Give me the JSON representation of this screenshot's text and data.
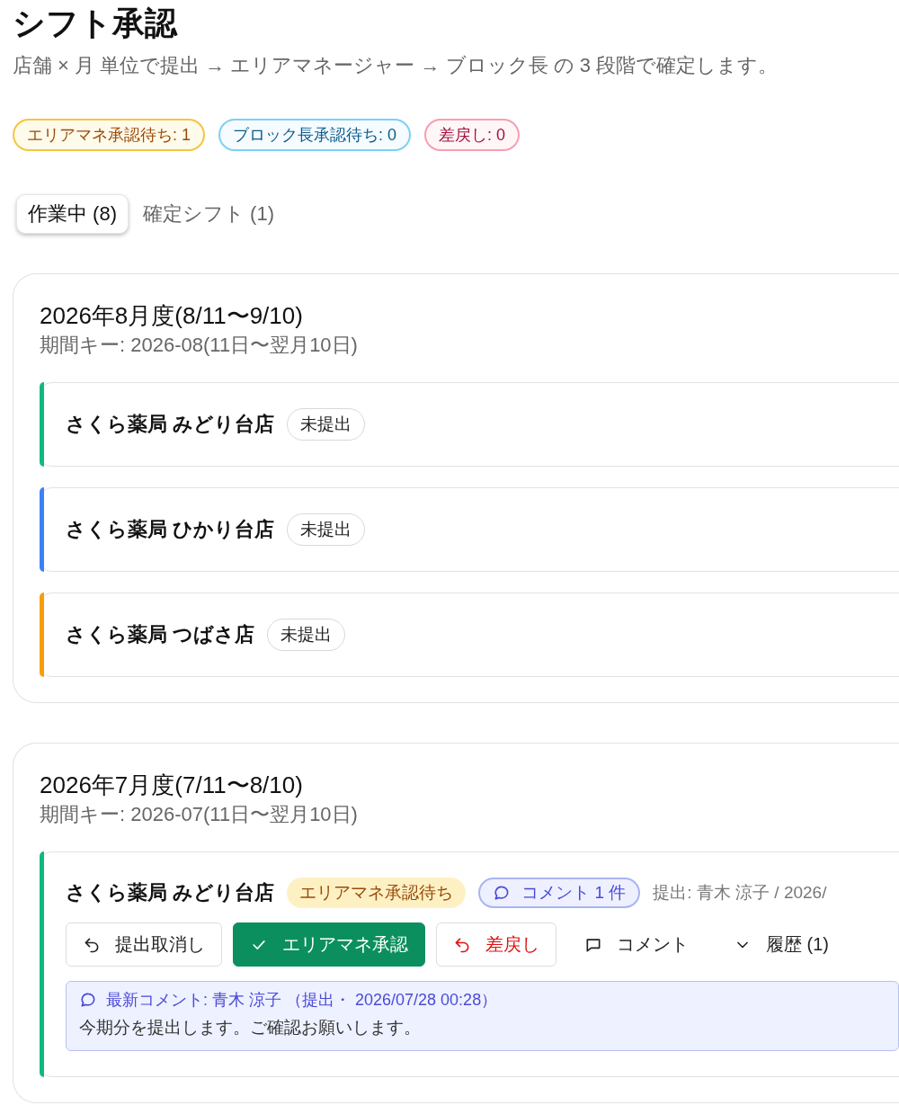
{
  "page": {
    "title": "シフト承認",
    "subtitle": "店舗 × 月 単位で提出 → エリアマネージャー → ブロック長 の 3 段階で確定します。"
  },
  "summary_badges": [
    {
      "label": "エリアマネ承認待ち: 1",
      "kind": "pending"
    },
    {
      "label": "ブロック長承認待ち: 0",
      "kind": "block"
    },
    {
      "label": "差戻し: 0",
      "kind": "returned"
    }
  ],
  "tabs": [
    {
      "label": "作業中 (8)",
      "selected": true
    },
    {
      "label": "確定シフト (1)",
      "selected": false
    }
  ],
  "periods": [
    {
      "title": "2026年8月度(8/11〜9/10)",
      "key": "期間キー: 2026-08(11日〜翌月10日)",
      "stores": [
        {
          "name": "さくら薬局 みどり台店",
          "color": "#10b981",
          "status": {
            "label": "未提出",
            "kind": "draft"
          }
        },
        {
          "name": "さくら薬局 ひかり台店",
          "color": "#3b82f6",
          "status": {
            "label": "未提出",
            "kind": "draft"
          }
        },
        {
          "name": "さくら薬局 つばさ店",
          "color": "#f59e0b",
          "status": {
            "label": "未提出",
            "kind": "draft"
          }
        }
      ]
    },
    {
      "title": "2026年7月度(7/11〜8/10)",
      "key": "期間キー: 2026-07(11日〜翌月10日)",
      "stores": [
        {
          "name": "さくら薬局 みどり台店",
          "color": "#10b981",
          "status": {
            "label": "エリアマネ承認待ち",
            "kind": "pending"
          },
          "comment_badge": "コメント 1 件",
          "submitted": "提出: 青木 涼子 / 2026/",
          "actions": [
            {
              "label": "提出取消し",
              "kind": "undo"
            },
            {
              "label": "エリアマネ承認",
              "kind": "approve"
            },
            {
              "label": "差戻し",
              "kind": "reject"
            },
            {
              "label": "コメント",
              "kind": "comment"
            },
            {
              "label": "履歴 (1)",
              "kind": "history"
            }
          ],
          "latest_comment": {
            "header": "最新コメント:  青木 涼子 （提出・ 2026/07/28 00:28）",
            "body": "今期分を提出します。ご確認お願いします。"
          }
        }
      ]
    }
  ]
}
